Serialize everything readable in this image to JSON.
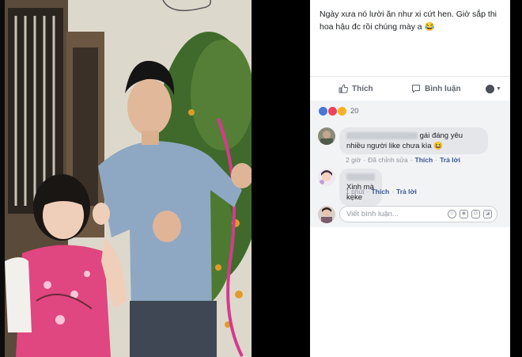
{
  "post": {
    "caption": "Ngày xưa nó lười ăn như xi cứt hen. Giờ sắp thi hoa hậu đc rồi chúng mày a 😂"
  },
  "actions": {
    "like_label": "Thích",
    "comment_label": "Bình luận"
  },
  "reactions": {
    "count": "20",
    "types": [
      "like-icon",
      "love-icon",
      "haha-icon"
    ]
  },
  "comments": [
    {
      "text": "gái đáng yêu nhiều người like chưa kìa 😆",
      "time": "2 giờ",
      "edited": "Đã chỉnh sửa",
      "like": "Thích",
      "reply": "Trả lời"
    },
    {
      "text": "Xinh mà kẹke",
      "time": "1 phút",
      "like": "Thích",
      "reply": "Trả lời"
    }
  ],
  "composer": {
    "placeholder": "Viết bình luận..."
  },
  "colors": {
    "link": "#385898",
    "like_reaction": "#4a76d8",
    "love_reaction": "#f0435b",
    "haha_reaction": "#f7b125"
  }
}
